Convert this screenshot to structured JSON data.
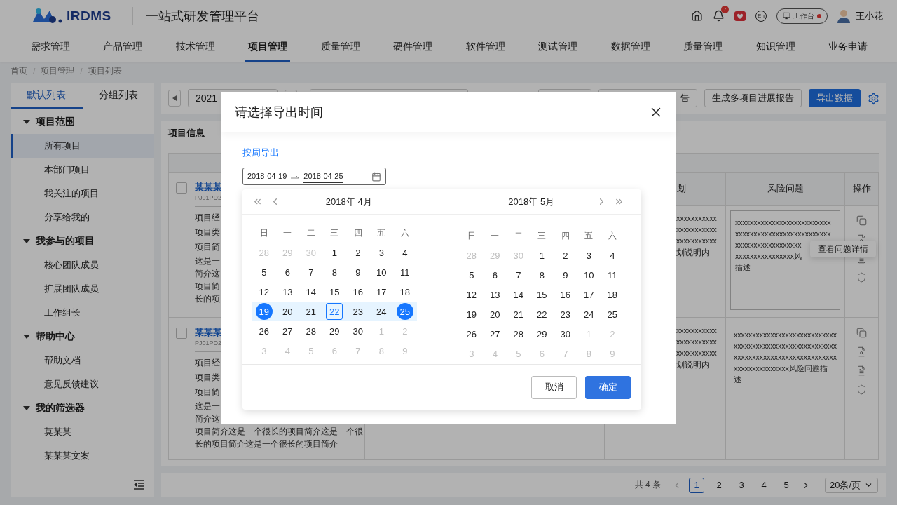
{
  "header": {
    "logo_text": "iRDMS",
    "title": "一站式研发管理平台",
    "notification_count": "7",
    "language": "En",
    "workbench": "工作台",
    "workbench_alert": true,
    "user": "王小花"
  },
  "nav": [
    {
      "label": "需求管理",
      "selected": false
    },
    {
      "label": "产品管理",
      "selected": false
    },
    {
      "label": "技术管理",
      "selected": false
    },
    {
      "label": "项目管理",
      "selected": true
    },
    {
      "label": "质量管理",
      "selected": false
    },
    {
      "label": "硬件管理",
      "selected": false
    },
    {
      "label": "软件管理",
      "selected": false
    },
    {
      "label": "测试管理",
      "selected": false
    },
    {
      "label": "数据管理",
      "selected": false
    },
    {
      "label": "质量管理",
      "selected": false
    },
    {
      "label": "知识管理",
      "selected": false
    },
    {
      "label": "业务申请",
      "selected": false
    }
  ],
  "breadcrumb": {
    "separator": "/",
    "items": [
      "首页",
      "项目管理",
      "项目列表"
    ]
  },
  "sidebar": {
    "tabs": [
      {
        "label": "默认列表",
        "selected": true
      },
      {
        "label": "分组列表",
        "selected": false
      }
    ],
    "groups": [
      {
        "label": "项目范围",
        "expanded": true,
        "children": [
          {
            "label": "所有项目",
            "selected": true
          },
          {
            "label": "本部门项目",
            "selected": false
          },
          {
            "label": "我关注的项目",
            "selected": false
          },
          {
            "label": "分享给我的",
            "selected": false
          }
        ]
      },
      {
        "label": "我参与的项目",
        "expanded": true,
        "children": [
          {
            "label": "核心团队成员",
            "selected": false
          },
          {
            "label": "扩展团队成员",
            "selected": false
          },
          {
            "label": "工作组长",
            "selected": false
          }
        ]
      },
      {
        "label": "帮助中心",
        "expanded": true,
        "children": [
          {
            "label": "帮助文档",
            "selected": false
          },
          {
            "label": "意见反馈建议",
            "selected": false
          }
        ]
      },
      {
        "label": "我的筛选器",
        "expanded": true,
        "children": [
          {
            "label": "莫某某",
            "selected": false
          },
          {
            "label": "某某某文案",
            "selected": false
          }
        ]
      }
    ]
  },
  "toolbar": {
    "period_select": "2021",
    "buttons": [
      {
        "label": "告",
        "kind": "default"
      },
      {
        "label": "生成多项目进展报告",
        "kind": "default"
      },
      {
        "label": "导出数据",
        "kind": "primary"
      }
    ]
  },
  "content": {
    "title": "项目信息",
    "headers": {
      "column_4": "划",
      "risk": "风险问题",
      "actions": "操作"
    },
    "rows": [
      {
        "checked": false,
        "name": "某某某",
        "code": "PJ01PD2",
        "fields": [
          "项目经",
          "项目类",
          "项目简"
        ],
        "description": [
          "这是一",
          "简介这",
          "项目简",
          "长的项"
        ],
        "column_4": [
          "xxxxxxxxxxx",
          "xxxxxxxxxxx",
          "xxxxxxxxxxx",
          "划说明内"
        ],
        "risk": [
          "xxxxxxxxxxxxxxxxxxxxxxxxxx",
          "xxxxxxxxxxxxxxxxxxxxxxxxxx",
          "xxxxxxxxxxxxxxxxxx",
          "xxxxxxxxxxxxxxxx风",
          "描述"
        ],
        "editing": true,
        "tooltip": "查看问题详情",
        "actions": [
          {
            "kind": "copy"
          },
          {
            "kind": "search"
          },
          {
            "kind": "doc"
          },
          {
            "kind": "shield"
          }
        ]
      },
      {
        "checked": false,
        "name": "某某某",
        "code": "PJ01PD2",
        "fields": [
          "项目经",
          "项目类",
          "项目简"
        ],
        "description": [
          "这是一",
          "简介这",
          "项目简介这是一个很长的项目简介这是一个很",
          "长的项目简介这是一个很长的项目简介"
        ],
        "column_4": [
          "xxxxxxxxxxx",
          "xxxxxxxxxxx",
          "xxxxxxxxxxx",
          "划说明内"
        ],
        "risk": [
          "xxxxxxxxxxxxxxxxxxxxxxxxxxxx",
          "xxxxxxxxxxxxxxxxxxxxxxxxxxxx",
          "xxxxxxxxxxxxxxxxxxxxxxxxxxxx",
          "xxxxxxxxxxxxxxx风险问题描",
          "述"
        ],
        "editing": false,
        "actions": [
          {
            "kind": "copy"
          },
          {
            "kind": "search"
          },
          {
            "kind": "doc"
          },
          {
            "kind": "shield"
          }
        ]
      }
    ]
  },
  "pagination": {
    "total": "共 4 条",
    "prev_disabled": true,
    "next_disabled": false,
    "pages": [
      {
        "label": "1",
        "selected": true
      },
      {
        "label": "2",
        "selected": false
      },
      {
        "label": "3",
        "selected": false
      },
      {
        "label": "4",
        "selected": false
      },
      {
        "label": "5",
        "selected": false
      }
    ],
    "page_size": "20条/页"
  },
  "modal": {
    "title": "请选择导出时间",
    "mode_link": "按周导出",
    "range": [
      {
        "value": "2018-04-19",
        "active": false
      },
      {
        "value": "2018-04-25",
        "active": true
      }
    ],
    "calendars": [
      {
        "title": "2018年 4月",
        "weekdays": [
          "日",
          "一",
          "二",
          "三",
          "四",
          "五",
          "六"
        ],
        "weeks": [
          {
            "in_range": false,
            "days": [
              {
                "d": "28",
                "muted": true,
                "selected": false,
                "today": false
              },
              {
                "d": "29",
                "muted": true,
                "selected": false,
                "today": false
              },
              {
                "d": "30",
                "muted": true,
                "selected": false,
                "today": false
              },
              {
                "d": "1",
                "muted": false,
                "selected": false,
                "today": false
              },
              {
                "d": "2",
                "muted": false,
                "selected": false,
                "today": false
              },
              {
                "d": "3",
                "muted": false,
                "selected": false,
                "today": false
              },
              {
                "d": "4",
                "muted": false,
                "selected": false,
                "today": false
              }
            ]
          },
          {
            "in_range": false,
            "days": [
              {
                "d": "5",
                "muted": false,
                "selected": false,
                "today": false
              },
              {
                "d": "6",
                "muted": false,
                "selected": false,
                "today": false
              },
              {
                "d": "7",
                "muted": false,
                "selected": false,
                "today": false
              },
              {
                "d": "8",
                "muted": false,
                "selected": false,
                "today": false
              },
              {
                "d": "9",
                "muted": false,
                "selected": false,
                "today": false
              },
              {
                "d": "10",
                "muted": false,
                "selected": false,
                "today": false
              },
              {
                "d": "11",
                "muted": false,
                "selected": false,
                "today": false
              }
            ]
          },
          {
            "in_range": false,
            "days": [
              {
                "d": "12",
                "muted": false,
                "selected": false,
                "today": false
              },
              {
                "d": "13",
                "muted": false,
                "selected": false,
                "today": false
              },
              {
                "d": "14",
                "muted": false,
                "selected": false,
                "today": false
              },
              {
                "d": "15",
                "muted": false,
                "selected": false,
                "today": false
              },
              {
                "d": "16",
                "muted": false,
                "selected": false,
                "today": false
              },
              {
                "d": "17",
                "muted": false,
                "selected": false,
                "today": false
              },
              {
                "d": "18",
                "muted": false,
                "selected": false,
                "today": false
              }
            ]
          },
          {
            "in_range": true,
            "days": [
              {
                "d": "19",
                "muted": false,
                "selected": true,
                "today": false
              },
              {
                "d": "20",
                "muted": false,
                "selected": false,
                "today": false
              },
              {
                "d": "21",
                "muted": false,
                "selected": false,
                "today": false
              },
              {
                "d": "22",
                "muted": false,
                "selected": false,
                "today": true
              },
              {
                "d": "23",
                "muted": false,
                "selected": false,
                "today": false
              },
              {
                "d": "24",
                "muted": false,
                "selected": false,
                "today": false
              },
              {
                "d": "25",
                "muted": false,
                "selected": true,
                "today": false
              }
            ]
          },
          {
            "in_range": false,
            "days": [
              {
                "d": "26",
                "muted": false,
                "selected": false,
                "today": false
              },
              {
                "d": "27",
                "muted": false,
                "selected": false,
                "today": false
              },
              {
                "d": "28",
                "muted": false,
                "selected": false,
                "today": false
              },
              {
                "d": "29",
                "muted": false,
                "selected": false,
                "today": false
              },
              {
                "d": "30",
                "muted": false,
                "selected": false,
                "today": false
              },
              {
                "d": "1",
                "muted": true,
                "selected": false,
                "today": false
              },
              {
                "d": "2",
                "muted": true,
                "selected": false,
                "today": false
              }
            ]
          },
          {
            "in_range": false,
            "days": [
              {
                "d": "3",
                "muted": true,
                "selected": false,
                "today": false
              },
              {
                "d": "4",
                "muted": true,
                "selected": false,
                "today": false
              },
              {
                "d": "5",
                "muted": true,
                "selected": false,
                "today": false
              },
              {
                "d": "6",
                "muted": true,
                "selected": false,
                "today": false
              },
              {
                "d": "7",
                "muted": true,
                "selected": false,
                "today": false
              },
              {
                "d": "8",
                "muted": true,
                "selected": false,
                "today": false
              },
              {
                "d": "9",
                "muted": true,
                "selected": false,
                "today": false
              }
            ]
          }
        ]
      },
      {
        "title": "2018年 5月",
        "weekdays": [
          "日",
          "一",
          "二",
          "三",
          "四",
          "五",
          "六"
        ],
        "weeks": [
          {
            "in_range": false,
            "days": [
              {
                "d": "28",
                "muted": true,
                "selected": false,
                "today": false
              },
              {
                "d": "29",
                "muted": true,
                "selected": false,
                "today": false
              },
              {
                "d": "30",
                "muted": true,
                "selected": false,
                "today": false
              },
              {
                "d": "1",
                "muted": false,
                "selected": false,
                "today": false
              },
              {
                "d": "2",
                "muted": false,
                "selected": false,
                "today": false
              },
              {
                "d": "3",
                "muted": false,
                "selected": false,
                "today": false
              },
              {
                "d": "4",
                "muted": false,
                "selected": false,
                "today": false
              }
            ]
          },
          {
            "in_range": false,
            "days": [
              {
                "d": "5",
                "muted": false,
                "selected": false,
                "today": false
              },
              {
                "d": "6",
                "muted": false,
                "selected": false,
                "today": false
              },
              {
                "d": "7",
                "muted": false,
                "selected": false,
                "today": false
              },
              {
                "d": "8",
                "muted": false,
                "selected": false,
                "today": false
              },
              {
                "d": "9",
                "muted": false,
                "selected": false,
                "today": false
              },
              {
                "d": "10",
                "muted": false,
                "selected": false,
                "today": false
              },
              {
                "d": "11",
                "muted": false,
                "selected": false,
                "today": false
              }
            ]
          },
          {
            "in_range": false,
            "days": [
              {
                "d": "12",
                "muted": false,
                "selected": false,
                "today": false
              },
              {
                "d": "13",
                "muted": false,
                "selected": false,
                "today": false
              },
              {
                "d": "14",
                "muted": false,
                "selected": false,
                "today": false
              },
              {
                "d": "15",
                "muted": false,
                "selected": false,
                "today": false
              },
              {
                "d": "16",
                "muted": false,
                "selected": false,
                "today": false
              },
              {
                "d": "17",
                "muted": false,
                "selected": false,
                "today": false
              },
              {
                "d": "18",
                "muted": false,
                "selected": false,
                "today": false
              }
            ]
          },
          {
            "in_range": false,
            "days": [
              {
                "d": "19",
                "muted": false,
                "selected": false,
                "today": false
              },
              {
                "d": "20",
                "muted": false,
                "selected": false,
                "today": false
              },
              {
                "d": "21",
                "muted": false,
                "selected": false,
                "today": false
              },
              {
                "d": "22",
                "muted": false,
                "selected": false,
                "today": false
              },
              {
                "d": "23",
                "muted": false,
                "selected": false,
                "today": false
              },
              {
                "d": "24",
                "muted": false,
                "selected": false,
                "today": false
              },
              {
                "d": "25",
                "muted": false,
                "selected": false,
                "today": false
              }
            ]
          },
          {
            "in_range": false,
            "days": [
              {
                "d": "26",
                "muted": false,
                "selected": false,
                "today": false
              },
              {
                "d": "27",
                "muted": false,
                "selected": false,
                "today": false
              },
              {
                "d": "28",
                "muted": false,
                "selected": false,
                "today": false
              },
              {
                "d": "29",
                "muted": false,
                "selected": false,
                "today": false
              },
              {
                "d": "30",
                "muted": false,
                "selected": false,
                "today": false
              },
              {
                "d": "1",
                "muted": true,
                "selected": false,
                "today": false
              },
              {
                "d": "2",
                "muted": true,
                "selected": false,
                "today": false
              }
            ]
          },
          {
            "in_range": false,
            "days": [
              {
                "d": "3",
                "muted": true,
                "selected": false,
                "today": false
              },
              {
                "d": "4",
                "muted": true,
                "selected": false,
                "today": false
              },
              {
                "d": "5",
                "muted": true,
                "selected": false,
                "today": false
              },
              {
                "d": "6",
                "muted": true,
                "selected": false,
                "today": false
              },
              {
                "d": "7",
                "muted": true,
                "selected": false,
                "today": false
              },
              {
                "d": "8",
                "muted": true,
                "selected": false,
                "today": false
              },
              {
                "d": "9",
                "muted": true,
                "selected": false,
                "today": false
              }
            ]
          }
        ]
      }
    ],
    "buttons": [
      {
        "label": "取消",
        "kind": "default"
      },
      {
        "label": "确定",
        "kind": "primary"
      }
    ]
  }
}
